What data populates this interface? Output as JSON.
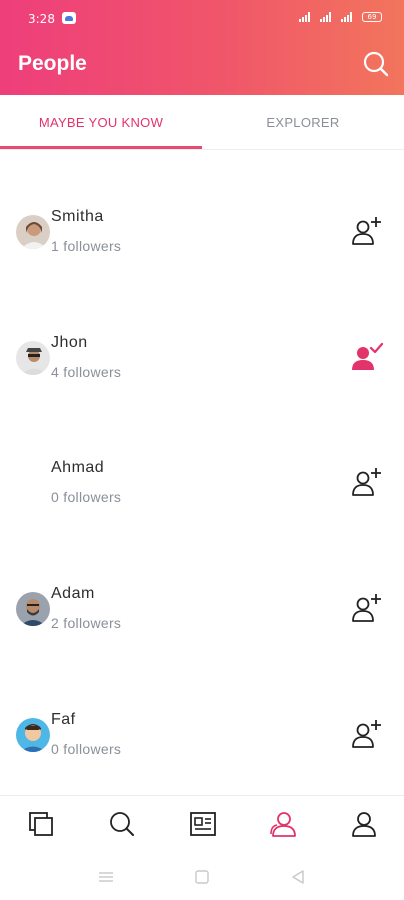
{
  "status_bar": {
    "time": "3:28",
    "battery": "69"
  },
  "header": {
    "title": "People",
    "search_icon": "search-icon"
  },
  "tabs": [
    {
      "label": "MAYBE YOU KNOW",
      "active": true
    },
    {
      "label": "EXPLORER",
      "active": false
    }
  ],
  "people": [
    {
      "name": "Smitha",
      "followers": "1 followers",
      "following": false,
      "avatar": "photo-woman"
    },
    {
      "name": "Jhon",
      "followers": "4 followers",
      "following": true,
      "avatar": "photo-man-hat"
    },
    {
      "name": "Ahmad",
      "followers": "0 followers",
      "following": false,
      "avatar": "none"
    },
    {
      "name": "Adam",
      "followers": "2 followers",
      "following": false,
      "avatar": "photo-man-beard"
    },
    {
      "name": "Faf",
      "followers": "0 followers",
      "following": false,
      "avatar": "cartoon-man"
    }
  ],
  "bottom_nav": [
    {
      "icon": "squares-icon",
      "active": false
    },
    {
      "icon": "search-icon",
      "active": false
    },
    {
      "icon": "newspaper-icon",
      "active": false
    },
    {
      "icon": "people-icon",
      "active": true
    },
    {
      "icon": "profile-icon",
      "active": false
    }
  ],
  "colors": {
    "accent": "#e2336a",
    "muted": "#8a8f99",
    "header_start": "#ee3e7b",
    "header_end": "#f2755c"
  }
}
